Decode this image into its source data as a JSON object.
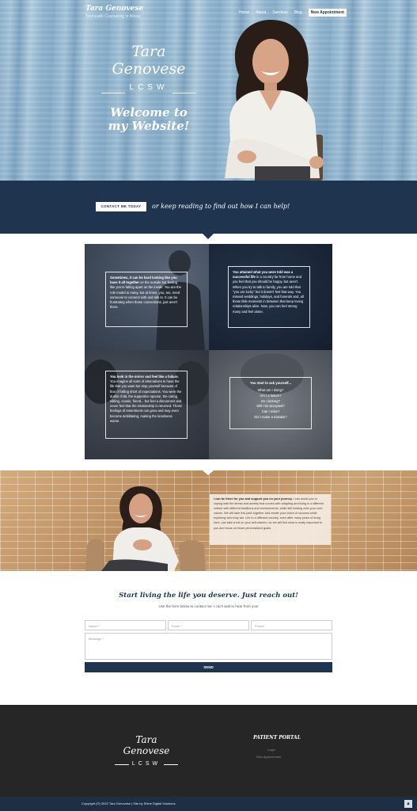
{
  "header": {
    "brand_title": "Tara Genovese",
    "brand_subtitle": "Telehealth Counseling in Illinois",
    "nav": [
      "Home",
      "About",
      "Services",
      "Blog"
    ],
    "nav_cta": "New Appointment"
  },
  "hero": {
    "name_line1": "Tara",
    "name_line2": "Genovese",
    "credential": "LCSW",
    "welcome": "Welcome to my Website!"
  },
  "band": {
    "cta_label": "CONTACT ME TODAY",
    "text": "or keep reading to find out how I can help!"
  },
  "grid": {
    "cell1": {
      "lead": "Sometimes, it can be hard looking like you have it all together",
      "body": " on the outside but feeling like you're falling apart on the inside. You are the role model to many, but at times, you, too, need someone to connect with and talk to. It can be frustrating when those connections, just aren't there."
    },
    "cell2": {
      "lead": "You attained what you were told was a successful life",
      "body": " in a country far from home and you feel that you should be happy, but aren't. When you try to talk to family, you are told that \"you are lucky\" but it doesn't feel that way. You missed weddings, holidays, and funerals and, all those little moments in between that keep loving relationships alive. Now, you can feel strong many and feel alone."
    },
    "cell3": {
      "lead": "You look in the mirror and feel like a failure.",
      "body": " You imagine all sorts of alternatives to have the life that you want but stop yourself because of fear of falling short of expectations. You were the dutiful child, the supportive spouse, the caring sibling, cousin, friend... but feel a disconnect and never feel that the relationship is returned. Those feelings of resentment can grow and may even become debilitating, making the loneliness worse."
    },
    "cell4": {
      "lead": "You start to ask yourself...",
      "lines": [
        "What am I doing?",
        "Am I a failure?",
        "Do I belong?",
        "Will I be accepted?",
        "Can I relax?",
        "Did I make a mistake?"
      ]
    }
  },
  "support": {
    "lead": "I can be there for you and support you on your journey.",
    "body": " I can assist you in coping with the stress and anxiety that comes with adapting and living in a different culture with different traditions and environments, while still holding onto your core values. We will take this path together and create your vision of success while exploring who truly are. Life in a different country, even after many years of living here, can take a toll on your self-esteem, so we will find what is really important to you and focus on those personalized goals."
  },
  "contact": {
    "title": "Start living the life you deserve. Just reach out!",
    "subtitle": "Use the form below to contact me. I can't wait to hear from you!",
    "name_placeholder": "Name *",
    "email_placeholder": "Email *",
    "phone_placeholder": "Phone",
    "message_placeholder": "Message *",
    "send_label": "SEND"
  },
  "footer": {
    "name_line1": "Tara",
    "name_line2": "Genovese",
    "credential": "LCSW",
    "portal_title": "PATIENT PORTAL",
    "portal_links": [
      "Login",
      "New Appointment"
    ],
    "copyright": "Copyright (©) 2022 Tara Genovese | Site by Shine Digital Solutions",
    "to_top_icon": "chevron-up-icon"
  },
  "colors": {
    "navy": "#1f344f",
    "footer_dark": "#262626",
    "bottom_bar": "#1c2f45",
    "hero_blue": "#95b9d3",
    "brick": "#c49a6c"
  }
}
